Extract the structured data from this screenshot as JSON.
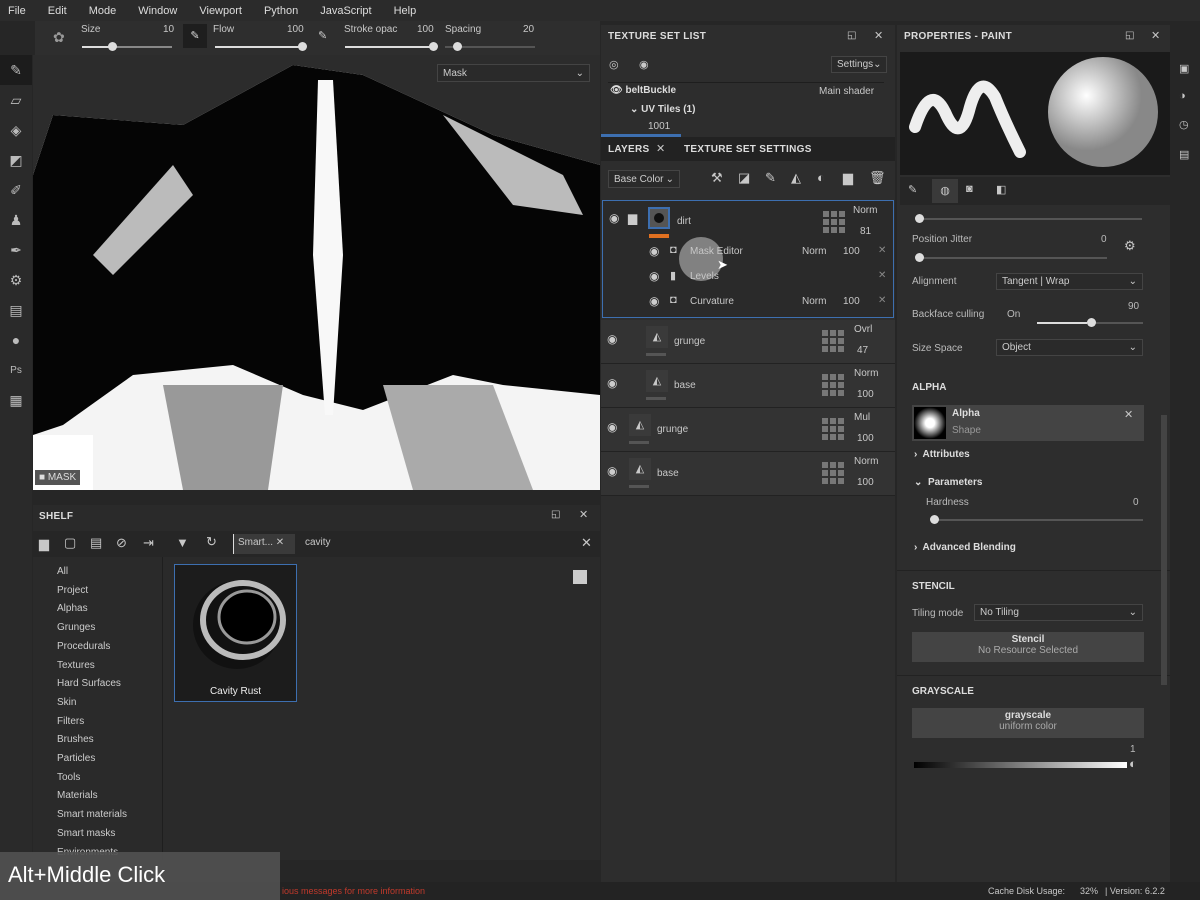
{
  "menu": [
    "File",
    "Edit",
    "Mode",
    "Window",
    "Viewport",
    "Python",
    "JavaScript",
    "Help"
  ],
  "tool_options": {
    "size_label": "Size",
    "size_value": "10",
    "flow_label": "Flow",
    "flow_value": "100",
    "stroke_label": "Stroke opac",
    "stroke_value": "100",
    "spacing_label": "Spacing",
    "spacing_value": "20",
    "size_fraction": 0.3,
    "flow_fraction": 1.0,
    "stroke_fraction": 1.0,
    "spacing_fraction": 0.1
  },
  "viewport": {
    "channel_select": "Mask",
    "mode_label": "MASK"
  },
  "texture_set_list": {
    "title": "TEXTURE SET LIST",
    "settings": "Settings",
    "set_name": "beltBuckle",
    "shader": "Main shader",
    "uv_tiles": "UV Tiles (1)",
    "tile": "1001"
  },
  "layers": {
    "tab_layers": "LAYERS",
    "tab_tss": "TEXTURE SET SETTINGS",
    "channel": "Base Color",
    "group": {
      "name": "dirt",
      "blend": "Norm",
      "opacity": "81"
    },
    "effects": [
      {
        "name": "Mask Editor",
        "blend": "Norm",
        "opacity": "100"
      },
      {
        "name": "Levels",
        "blend": "",
        "opacity": ""
      },
      {
        "name": "Curvature",
        "blend": "Norm",
        "opacity": "100"
      }
    ],
    "items": [
      {
        "name": "grunge",
        "blend": "Ovrl",
        "opacity": "47"
      },
      {
        "name": "base",
        "blend": "Norm",
        "opacity": "100"
      },
      {
        "name": "grunge",
        "blend": "Mul",
        "opacity": "100"
      },
      {
        "name": "base",
        "blend": "Norm",
        "opacity": "100"
      }
    ]
  },
  "shelf": {
    "title": "SHELF",
    "filter_tag": "Smart...",
    "search": "cavity",
    "categories": [
      "All",
      "Project",
      "Alphas",
      "Grunges",
      "Procedurals",
      "Textures",
      "Hard Surfaces",
      "Skin",
      "Filters",
      "Brushes",
      "Particles",
      "Tools",
      "Materials",
      "Smart materials",
      "Smart masks",
      "Environments"
    ],
    "result": "Cavity Rust"
  },
  "properties": {
    "title": "PROPERTIES - PAINT",
    "position_jitter_label": "Position Jitter",
    "position_jitter": "0",
    "alignment_label": "Alignment",
    "alignment": "Tangent | Wrap",
    "backface_label": "Backface culling",
    "backface_state": "On",
    "backface_value": "90",
    "size_space_label": "Size Space",
    "size_space": "Object",
    "alpha_section": "ALPHA",
    "alpha_name": "Alpha",
    "alpha_sub": "Shape",
    "attributes": "Attributes",
    "parameters": "Parameters",
    "hardness_label": "Hardness",
    "hardness": "0",
    "advanced_blending": "Advanced Blending",
    "stencil_section": "STENCIL",
    "tiling_label": "Tiling mode",
    "tiling": "No Tiling",
    "stencil_name": "Stencil",
    "stencil_sub": "No Resource Selected",
    "grayscale_section": "GRAYSCALE",
    "grayscale_name": "grayscale",
    "grayscale_sub": "uniform color",
    "grayscale_value": "1"
  },
  "status": {
    "message": "ious messages for more information",
    "cache": "Cache Disk Usage:",
    "cache_value": "32%",
    "version": "| Version: 6.2.2"
  },
  "overlay": {
    "shortcut": "Alt+Middle Click"
  },
  "colors": {
    "accent": "#3d6fb0",
    "orange": "#e07020",
    "error": "#c0392b"
  }
}
